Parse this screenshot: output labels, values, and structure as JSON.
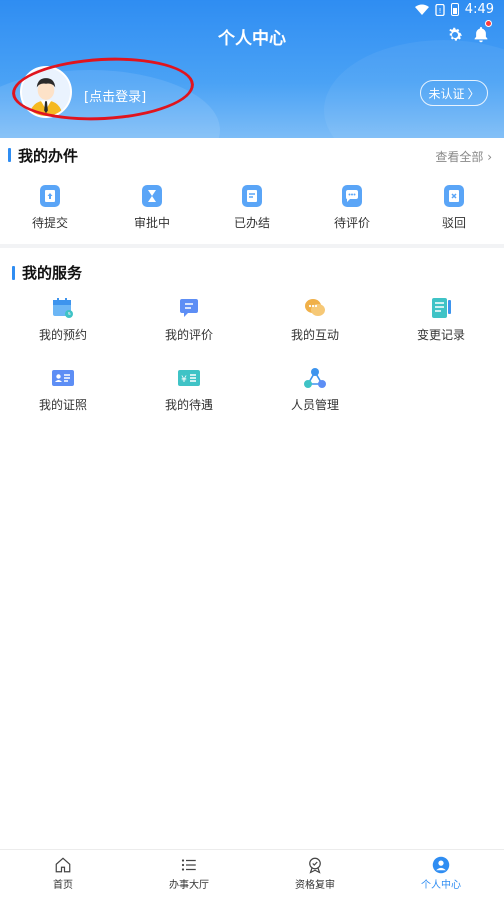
{
  "status_bar": {
    "time": "4:49"
  },
  "header": {
    "title": "个人中心",
    "login_text": "[点击登录]",
    "verify_label": "未认证",
    "verify_chevron": "〉"
  },
  "affairs": {
    "title": "我的办件",
    "view_all": "查看全部",
    "items": [
      {
        "label": "待提交",
        "icon": "upload-doc-icon"
      },
      {
        "label": "审批中",
        "icon": "hourglass-icon"
      },
      {
        "label": "已办结",
        "icon": "done-doc-icon"
      },
      {
        "label": "待评价",
        "icon": "chat-icon"
      },
      {
        "label": "驳回",
        "icon": "reject-doc-icon"
      }
    ]
  },
  "services": {
    "title": "我的服务",
    "items": [
      {
        "label": "我的预约",
        "icon": "calendar-icon"
      },
      {
        "label": "我的评价",
        "icon": "comment-icon"
      },
      {
        "label": "我的互动",
        "icon": "interaction-icon"
      },
      {
        "label": "变更记录",
        "icon": "record-icon"
      },
      {
        "label": "我的证照",
        "icon": "id-card-icon"
      },
      {
        "label": "我的待遇",
        "icon": "benefit-icon"
      },
      {
        "label": "人员管理",
        "icon": "people-network-icon"
      }
    ]
  },
  "bottom_nav": {
    "items": [
      {
        "label": "首页",
        "icon": "home-icon"
      },
      {
        "label": "办事大厅",
        "icon": "list-icon"
      },
      {
        "label": "资格复审",
        "icon": "badge-icon"
      },
      {
        "label": "个人中心",
        "icon": "user-icon"
      }
    ],
    "active_index": 3
  },
  "colors": {
    "primary": "#2f8df2",
    "annotation": "#e0141e",
    "notification_dot": "#ff3b3b"
  }
}
